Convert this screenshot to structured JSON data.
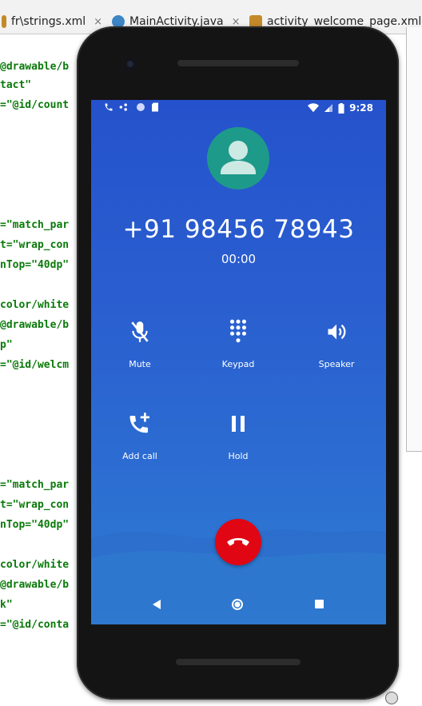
{
  "ide": {
    "tabs": [
      {
        "label": "fr\\strings.xml",
        "close": "×"
      },
      {
        "label": "MainActivity.java",
        "close": "×"
      },
      {
        "label": "activity_welcome_page.xml",
        "close": ""
      }
    ],
    "code_lines": [
      {
        "text": "@drawable/b",
        "type": "green"
      },
      {
        "text": "tact\"",
        "type": "green"
      },
      {
        "text": "=\"@id/count",
        "type": "green"
      },
      {
        "text": "=\"match_par",
        "type": "green"
      },
      {
        "text": "t=\"wrap_con",
        "type": "green"
      },
      {
        "text": "nTop=\"40dp\"",
        "type": "green"
      },
      {
        "text": "color/white",
        "type": "green"
      },
      {
        "text": "@drawable/b",
        "type": "green"
      },
      {
        "text": "p\"",
        "type": "green"
      },
      {
        "text": "=\"@id/welcm",
        "type": "green"
      },
      {
        "text": "=\"match_par",
        "type": "green"
      },
      {
        "text": "t=\"wrap_con",
        "type": "green"
      },
      {
        "text": "nTop=\"40dp\"",
        "type": "green"
      },
      {
        "text": "color/white",
        "type": "green"
      },
      {
        "text": "@drawable/b",
        "type": "green"
      },
      {
        "text": "k\"",
        "type": "green"
      },
      {
        "text": "=\"@id/conta",
        "type": "green"
      }
    ]
  },
  "phone": {
    "status_bar": {
      "time": "9:28",
      "left_icons": [
        "phone-icon",
        "wifi-calling-icon",
        "circle-icon",
        "sd-card-icon"
      ],
      "right_icons": [
        "wifi-icon",
        "signal-icon",
        "battery-icon"
      ]
    },
    "call": {
      "number": "+91 98456 78943",
      "timer": "00:00"
    },
    "controls": {
      "mute": {
        "label": "Mute",
        "icon": "mic-off-icon"
      },
      "keypad": {
        "label": "Keypad",
        "icon": "dialpad-icon"
      },
      "speaker": {
        "label": "Speaker",
        "icon": "speaker-icon"
      },
      "add_call": {
        "label": "Add call",
        "icon": "add-call-icon"
      },
      "hold": {
        "label": "Hold",
        "icon": "pause-icon"
      }
    },
    "end_call": {
      "icon": "end-call-icon",
      "color": "#e00613"
    },
    "navbar": [
      "back-icon",
      "home-icon",
      "recents-icon"
    ],
    "colors": {
      "screen_top": "#2552cc",
      "screen_bottom": "#2f80d3",
      "avatar": "#1e9a8a"
    }
  }
}
